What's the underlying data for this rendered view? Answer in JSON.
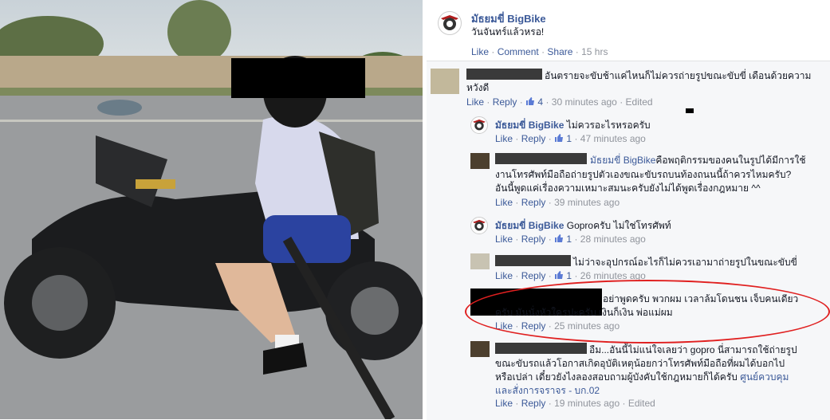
{
  "post": {
    "author": "มัธยมขี่ BigBike",
    "text": "วันจันทร์แล้วหรอ!",
    "actions": {
      "like": "Like",
      "comment": "Comment",
      "share": "Share"
    },
    "time": "15 hrs"
  },
  "comments": [
    {
      "text": "อันตรายจะขับช้าแค่ไหนก็ไม่ควรถ่ายรูปขณะขับขี่ เดือนด้วยความ",
      "text2": "หวังดี",
      "like": "Like",
      "reply": "Reply",
      "likes": "4",
      "time": "30 minutes ago",
      "edited": "Edited"
    },
    {
      "author": "มัธยมขี่ BigBike",
      "text": "ไม่ควรอะไรหรอครับ",
      "like": "Like",
      "reply": "Reply",
      "likes": "1",
      "time": "47 minutes ago"
    },
    {
      "mention": "มัธยมขี่ BigBike",
      "text": "คือพฤติกรรมของคนในรูปได้มีการใช้",
      "text2": "งานโทรศัพท์มือถือถ่ายรูปตัวเองขณะขับรถบนท้องถนนนี้ถ้าควรไหมครับ?",
      "text3": "อันนี้พูดแค่เรื่องความเหมาะสมนะครับยังไม่ได้พูดเรื่องกฎหมาย ^^",
      "like": "Like",
      "reply": "Reply",
      "time": "39 minutes ago"
    },
    {
      "author": "มัธยมขี่ BigBike",
      "text": "Goproครับ ไม่ใช่โทรศัพท์",
      "like": "Like",
      "reply": "Reply",
      "likes": "1",
      "time": "28 minutes ago"
    },
    {
      "text": "ไม่ว่าจะอุปกรณ์อะไรก็ไม่ควรเอามาถ่ายรูปในขณะขับขี่",
      "like": "Like",
      "reply": "Reply",
      "likes": "1",
      "time": "26 minutes ago"
    },
    {
      "text": "อย่าพูดครับ พวกผม เวลาล้มโดนชน เจ็บคนเดียว",
      "text2": "ครับ มันนั่งหัวใครปะครับ เงินก็เงิน พ่อแม่ผม",
      "like": "Like",
      "reply": "Reply",
      "time": "25 minutes ago"
    },
    {
      "text": "อืม...อันนี้ไม่แน่ใจเลยว่า gopro นี่สามารถใช้ถ่ายรูป",
      "text2": "ขณะขับรถแล้วโอกาสเกิดอุบัติเหตุน้อยกว่าโทรศัพท์มือถือที่ผมได้บอกไป",
      "text3": "หรือเปล่า เดี๋ยวยังไงลองสอบถามผู้บังคับใช้กฎหมายก็ได้ครับ",
      "link": "ศูนย์ควบคุม",
      "link2": "และสั่งการจราจร - บก.02",
      "like": "Like",
      "reply": "Reply",
      "time": "19 minutes ago",
      "edited": "Edited"
    }
  ],
  "colors": {
    "link": "#3b5998",
    "meta": "#90949c",
    "highlight": "#e02020"
  }
}
